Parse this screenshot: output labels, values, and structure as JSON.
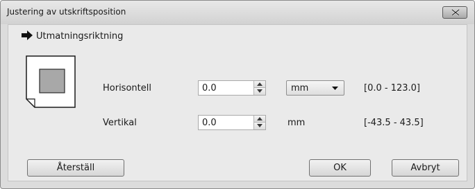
{
  "window": {
    "title": "Justering av utskriftsposition",
    "close_icon": "close-x-icon"
  },
  "section": {
    "icon": "right-arrow-icon",
    "label": "Utmatningsriktning"
  },
  "preview": {
    "icon": "paper-position-icon"
  },
  "horizontal": {
    "label": "Horisontell",
    "value": "0.0",
    "unit_selected": "mm",
    "range": "[0.0 - 123.0]"
  },
  "vertical": {
    "label": "Vertikal",
    "value": "0.0",
    "unit": "mm",
    "range": "[-43.5 - 43.5]"
  },
  "buttons": {
    "reset": "Återställ",
    "ok": "OK",
    "cancel": "Avbryt"
  }
}
